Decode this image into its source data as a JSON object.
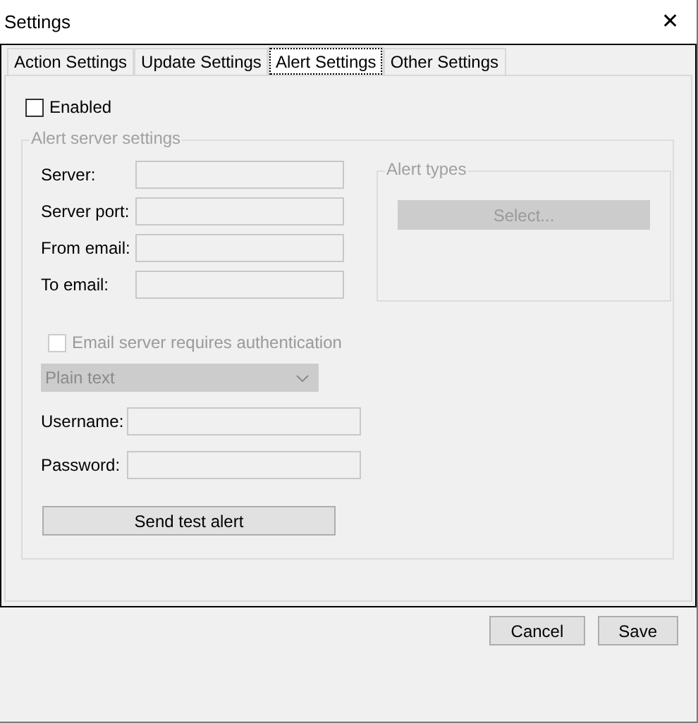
{
  "window": {
    "title": "Settings",
    "close": "✕"
  },
  "tabs": [
    {
      "label": "Action Settings",
      "selected": false
    },
    {
      "label": "Update Settings",
      "selected": false
    },
    {
      "label": "Alert Settings",
      "selected": true
    },
    {
      "label": "Other Settings",
      "selected": false
    }
  ],
  "enabled": {
    "label": "Enabled",
    "checked": false
  },
  "server_group": {
    "title": "Alert server settings",
    "fields": [
      {
        "label": "Server:"
      },
      {
        "label": "Server port:"
      },
      {
        "label": "From email:"
      },
      {
        "label": "To email:"
      }
    ],
    "alert_types": {
      "title": "Alert types",
      "button": {
        "label": "Select...",
        "disabled": true
      }
    },
    "auth": {
      "label": "Email server requires authentication",
      "checked": false,
      "disabled": true
    },
    "auth_mode": {
      "value": "Plain text",
      "disabled": true
    },
    "credentials": [
      {
        "label": "Username:"
      },
      {
        "label": "Password:"
      }
    ],
    "test_button": "Send test alert"
  },
  "buttons": [
    "Cancel",
    "Save"
  ]
}
